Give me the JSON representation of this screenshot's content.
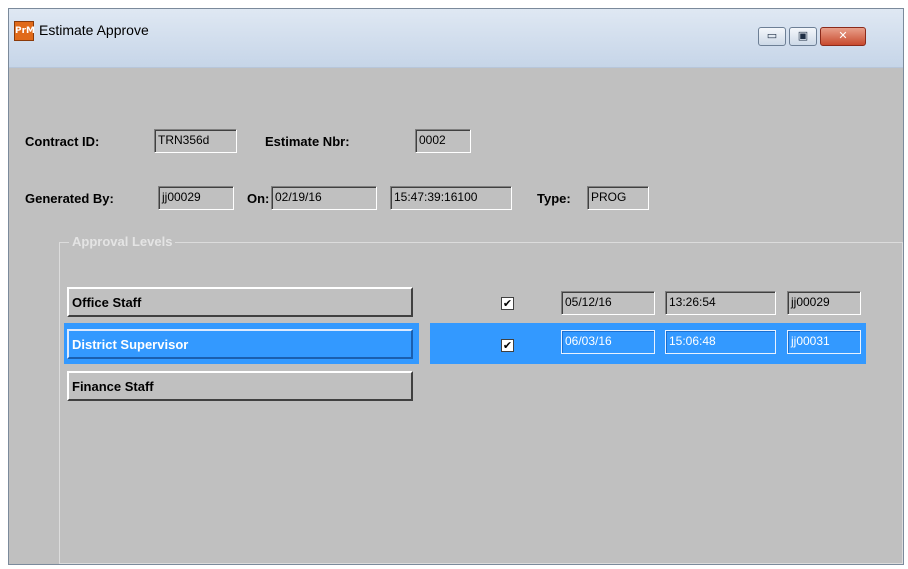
{
  "window": {
    "title": "Estimate Approve",
    "app_icon_text": "PrM",
    "controls": {
      "minimize": "▭",
      "maximize": "▣",
      "close": "✕"
    }
  },
  "header": {
    "contract_id_label": "Contract ID:",
    "contract_id": "TRN356d",
    "estimate_nbr_label": "Estimate Nbr:",
    "estimate_nbr": "0002",
    "generated_by_label": "Generated By:",
    "generated_by": "jj00029",
    "on_label": "On:",
    "on_date": "02/19/16",
    "on_time": "15:47:39:16100",
    "type_label": "Type:",
    "type": "PROG"
  },
  "approval": {
    "group_title": "Approval Levels",
    "levels": [
      {
        "label": "Office Staff",
        "checked": "✔",
        "date": "05/12/16",
        "time": "13:26:54",
        "user": "jj00029",
        "selected": false
      },
      {
        "label": "District Supervisor",
        "checked": "✔",
        "date": "06/03/16",
        "time": "15:06:48",
        "user": "jj00031",
        "selected": true
      },
      {
        "label": "Finance Staff",
        "selected": false
      }
    ]
  },
  "colors": {
    "selection": "#3399ff",
    "window_bg": "#c0c0c0"
  }
}
